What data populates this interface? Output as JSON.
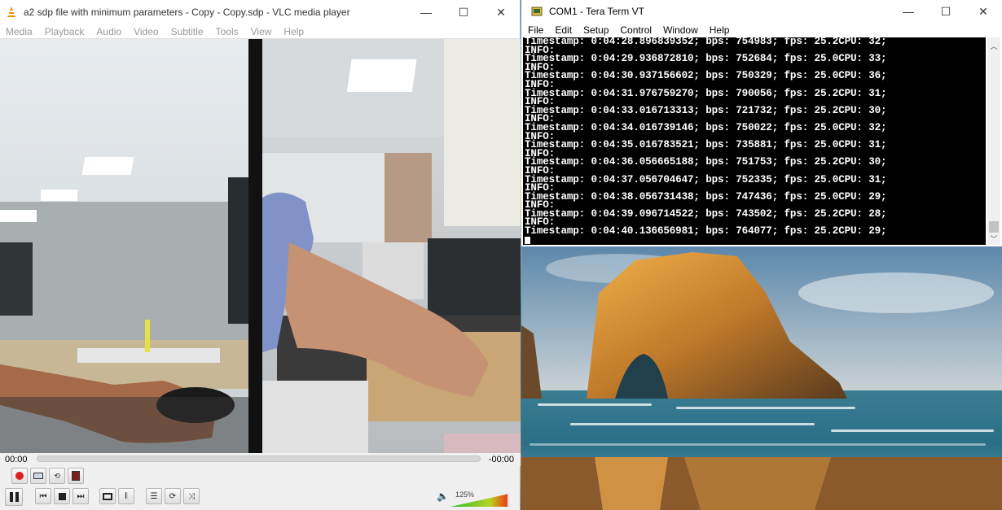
{
  "vlc": {
    "title": "a2 sdp file with minimum parameters - Copy - Copy.sdp - VLC media player",
    "menu": [
      "Media",
      "Playback",
      "Audio",
      "Video",
      "Subtitle",
      "Tools",
      "View",
      "Help"
    ],
    "time_elapsed": "00:00",
    "time_remaining": "-00:00",
    "volume_label": "125%",
    "volume_level_percent": 125,
    "window_buttons": {
      "minimize": "—",
      "maximize": "☐",
      "close": "✕"
    }
  },
  "teraterm": {
    "title": "COM1 - Tera Term VT",
    "menu": [
      "File",
      "Edit",
      "Setup",
      "Control",
      "Window",
      "Help"
    ],
    "window_buttons": {
      "minimize": "—",
      "maximize": "☐",
      "close": "✕"
    },
    "lines": [
      "Timestamp: 0:04:28.896839352; bps: 754983; fps: 25.2CPU: 32;",
      "INFO:",
      "Timestamp: 0:04:29.936872810; bps: 752684; fps: 25.0CPU: 33;",
      "INFO:",
      "Timestamp: 0:04:30.937156602; bps: 750329; fps: 25.0CPU: 36;",
      "INFO:",
      "Timestamp: 0:04:31.976759270; bps: 790056; fps: 25.2CPU: 31;",
      "INFO:",
      "Timestamp: 0:04:33.016713313; bps: 721732; fps: 25.2CPU: 30;",
      "INFO:",
      "Timestamp: 0:04:34.016739146; bps: 750022; fps: 25.0CPU: 32;",
      "INFO:",
      "Timestamp: 0:04:35.016783521; bps: 735881; fps: 25.0CPU: 31;",
      "INFO:",
      "Timestamp: 0:04:36.056665188; bps: 751753; fps: 25.2CPU: 30;",
      "INFO:",
      "Timestamp: 0:04:37.056704647; bps: 752335; fps: 25.0CPU: 31;",
      "INFO:",
      "Timestamp: 0:04:38.056731438; bps: 747436; fps: 25.0CPU: 29;",
      "INFO:",
      "Timestamp: 0:04:39.096714522; bps: 743502; fps: 25.2CPU: 28;",
      "INFO:",
      "Timestamp: 0:04:40.136656981; bps: 764077; fps: 25.2CPU: 29;"
    ]
  },
  "colors": {
    "terminal_bg": "#000000",
    "terminal_fg": "#ffffff",
    "vlc_record": "#e02020",
    "vlc_cone": "#f28c00"
  }
}
